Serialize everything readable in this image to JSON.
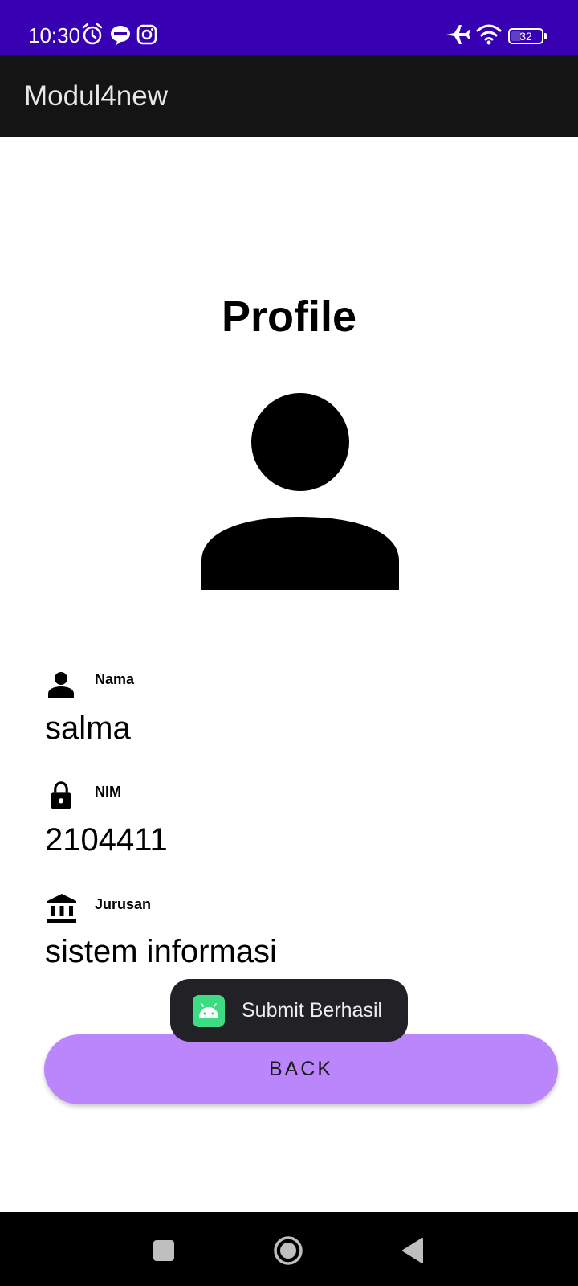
{
  "status_bar": {
    "time": "10:30",
    "battery": "32",
    "battery_level": 0.32,
    "icons": [
      "alarm-icon",
      "line-icon",
      "instagram-icon",
      "airplane-icon",
      "wifi-icon",
      "battery-icon"
    ],
    "background": "#3700B3"
  },
  "app_bar": {
    "title": "Modul4new",
    "background": "#141414"
  },
  "profile": {
    "title": "Profile",
    "avatar_icon": "person-icon",
    "fields": [
      {
        "label": "Nama",
        "value": "salma",
        "icon": "person-icon"
      },
      {
        "label": "NIM",
        "value": "2104411",
        "icon": "lock-icon"
      },
      {
        "label": "Jurusan",
        "value": "sistem informasi",
        "icon": "bank-icon"
      }
    ]
  },
  "back_button": {
    "label": "BACK",
    "color": "#BB86FC"
  },
  "toast": {
    "message": "Submit Berhasil",
    "icon": "android-icon",
    "icon_color": "#3DDC84"
  },
  "nav_bar": {
    "buttons": [
      "recents-icon",
      "home-icon",
      "back-icon"
    ]
  }
}
